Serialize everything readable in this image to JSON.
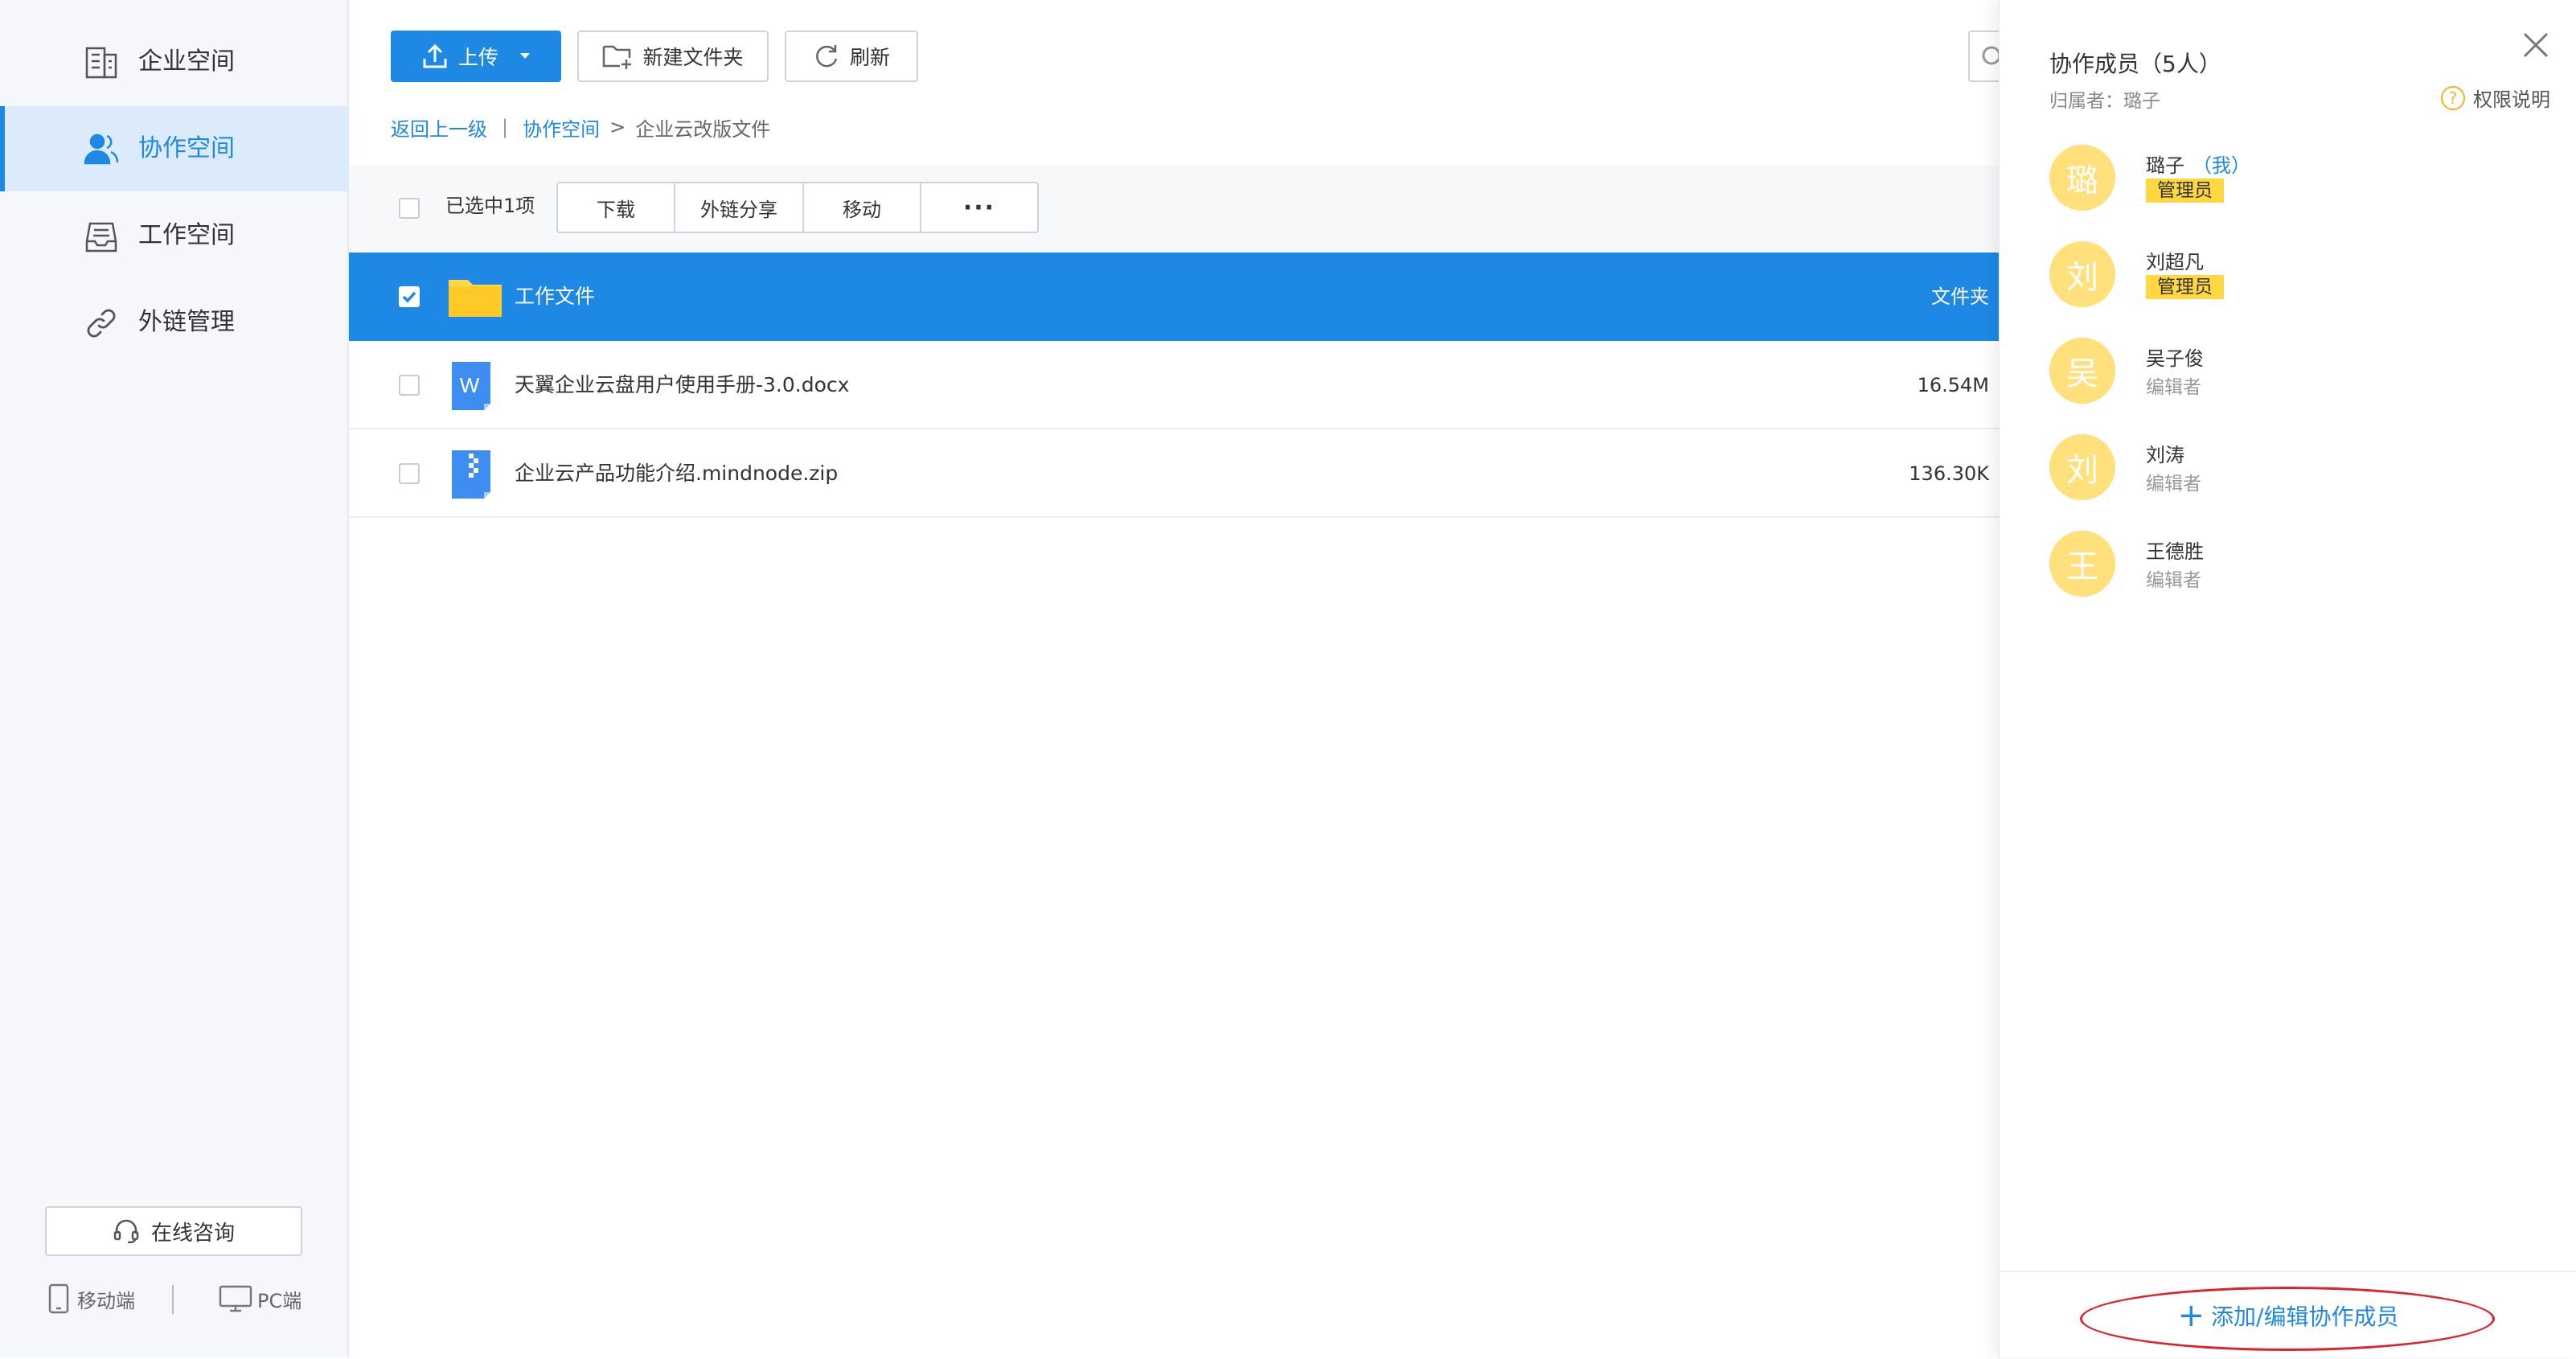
{
  "sidebar": {
    "items": [
      {
        "label": "企业空间",
        "icon": "building-icon"
      },
      {
        "label": "协作空间",
        "icon": "people-icon",
        "active": true
      },
      {
        "label": "工作空间",
        "icon": "inbox-tray-icon"
      },
      {
        "label": "外链管理",
        "icon": "link-icon"
      }
    ],
    "consult_label": "在线咨询",
    "mobile_label": "移动端",
    "pc_label": "PC端"
  },
  "toolbar": {
    "upload_label": "上传",
    "new_folder_label": "新建文件夹",
    "refresh_label": "刷新"
  },
  "breadcrumb": {
    "back": "返回上一级",
    "sep1": "|",
    "crumb1": "协作空间",
    "sep2": ">",
    "current": "企业云改版文件"
  },
  "action_bar": {
    "selected_text": "已选中1项",
    "download": "下载",
    "share_link": "外链分享",
    "move": "移动",
    "more": "···"
  },
  "files": [
    {
      "name": "工作文件",
      "size": "文件夹",
      "type": "folder",
      "selected": true
    },
    {
      "name": "天翼企业云盘用户使用手册-3.0.docx",
      "size": "16.54M",
      "type": "word-doc",
      "icon_letter": "W",
      "selected": false
    },
    {
      "name": "企业云产品功能介绍.mindnode.zip",
      "size": "136.30K",
      "type": "zip",
      "selected": false
    }
  ],
  "panel": {
    "title": "协作成员（5人）",
    "owner": "归属者：璐子",
    "permission_help": "权限说明",
    "members": [
      {
        "avatar": "璐",
        "name": "璐子",
        "me": "（我）",
        "role": "管理员",
        "admin": true
      },
      {
        "avatar": "刘",
        "name": "刘超凡",
        "role": "管理员",
        "admin": true
      },
      {
        "avatar": "吴",
        "name": "吴子俊",
        "role": "编辑者",
        "admin": false
      },
      {
        "avatar": "刘",
        "name": "刘涛",
        "role": "编辑者",
        "admin": false
      },
      {
        "avatar": "王",
        "name": "王德胜",
        "role": "编辑者",
        "admin": false
      }
    ],
    "add_members": "添加/编辑协作成员"
  },
  "colors": {
    "accent": "#1e88e5",
    "avatar_bg": "#ffe07a",
    "admin_badge": "#ffd740",
    "highlight": "#e0202a"
  }
}
